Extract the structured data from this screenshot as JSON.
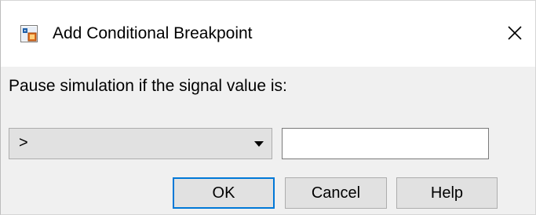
{
  "window": {
    "title": "Add Conditional Breakpoint",
    "app_icon": "simulink-breakpoint-icon",
    "close_icon": "close-icon"
  },
  "form": {
    "prompt": "Pause simulation if the signal value is:",
    "operator": {
      "selected": ">",
      "icon": "chevron-down-icon"
    },
    "value": {
      "text": "",
      "placeholder": ""
    }
  },
  "buttons": {
    "ok": "OK",
    "cancel": "Cancel",
    "help": "Help"
  },
  "colors": {
    "focus_border": "#0078d7",
    "button_bg": "#e1e1e1",
    "dialog_bg": "#f0f0f0"
  }
}
